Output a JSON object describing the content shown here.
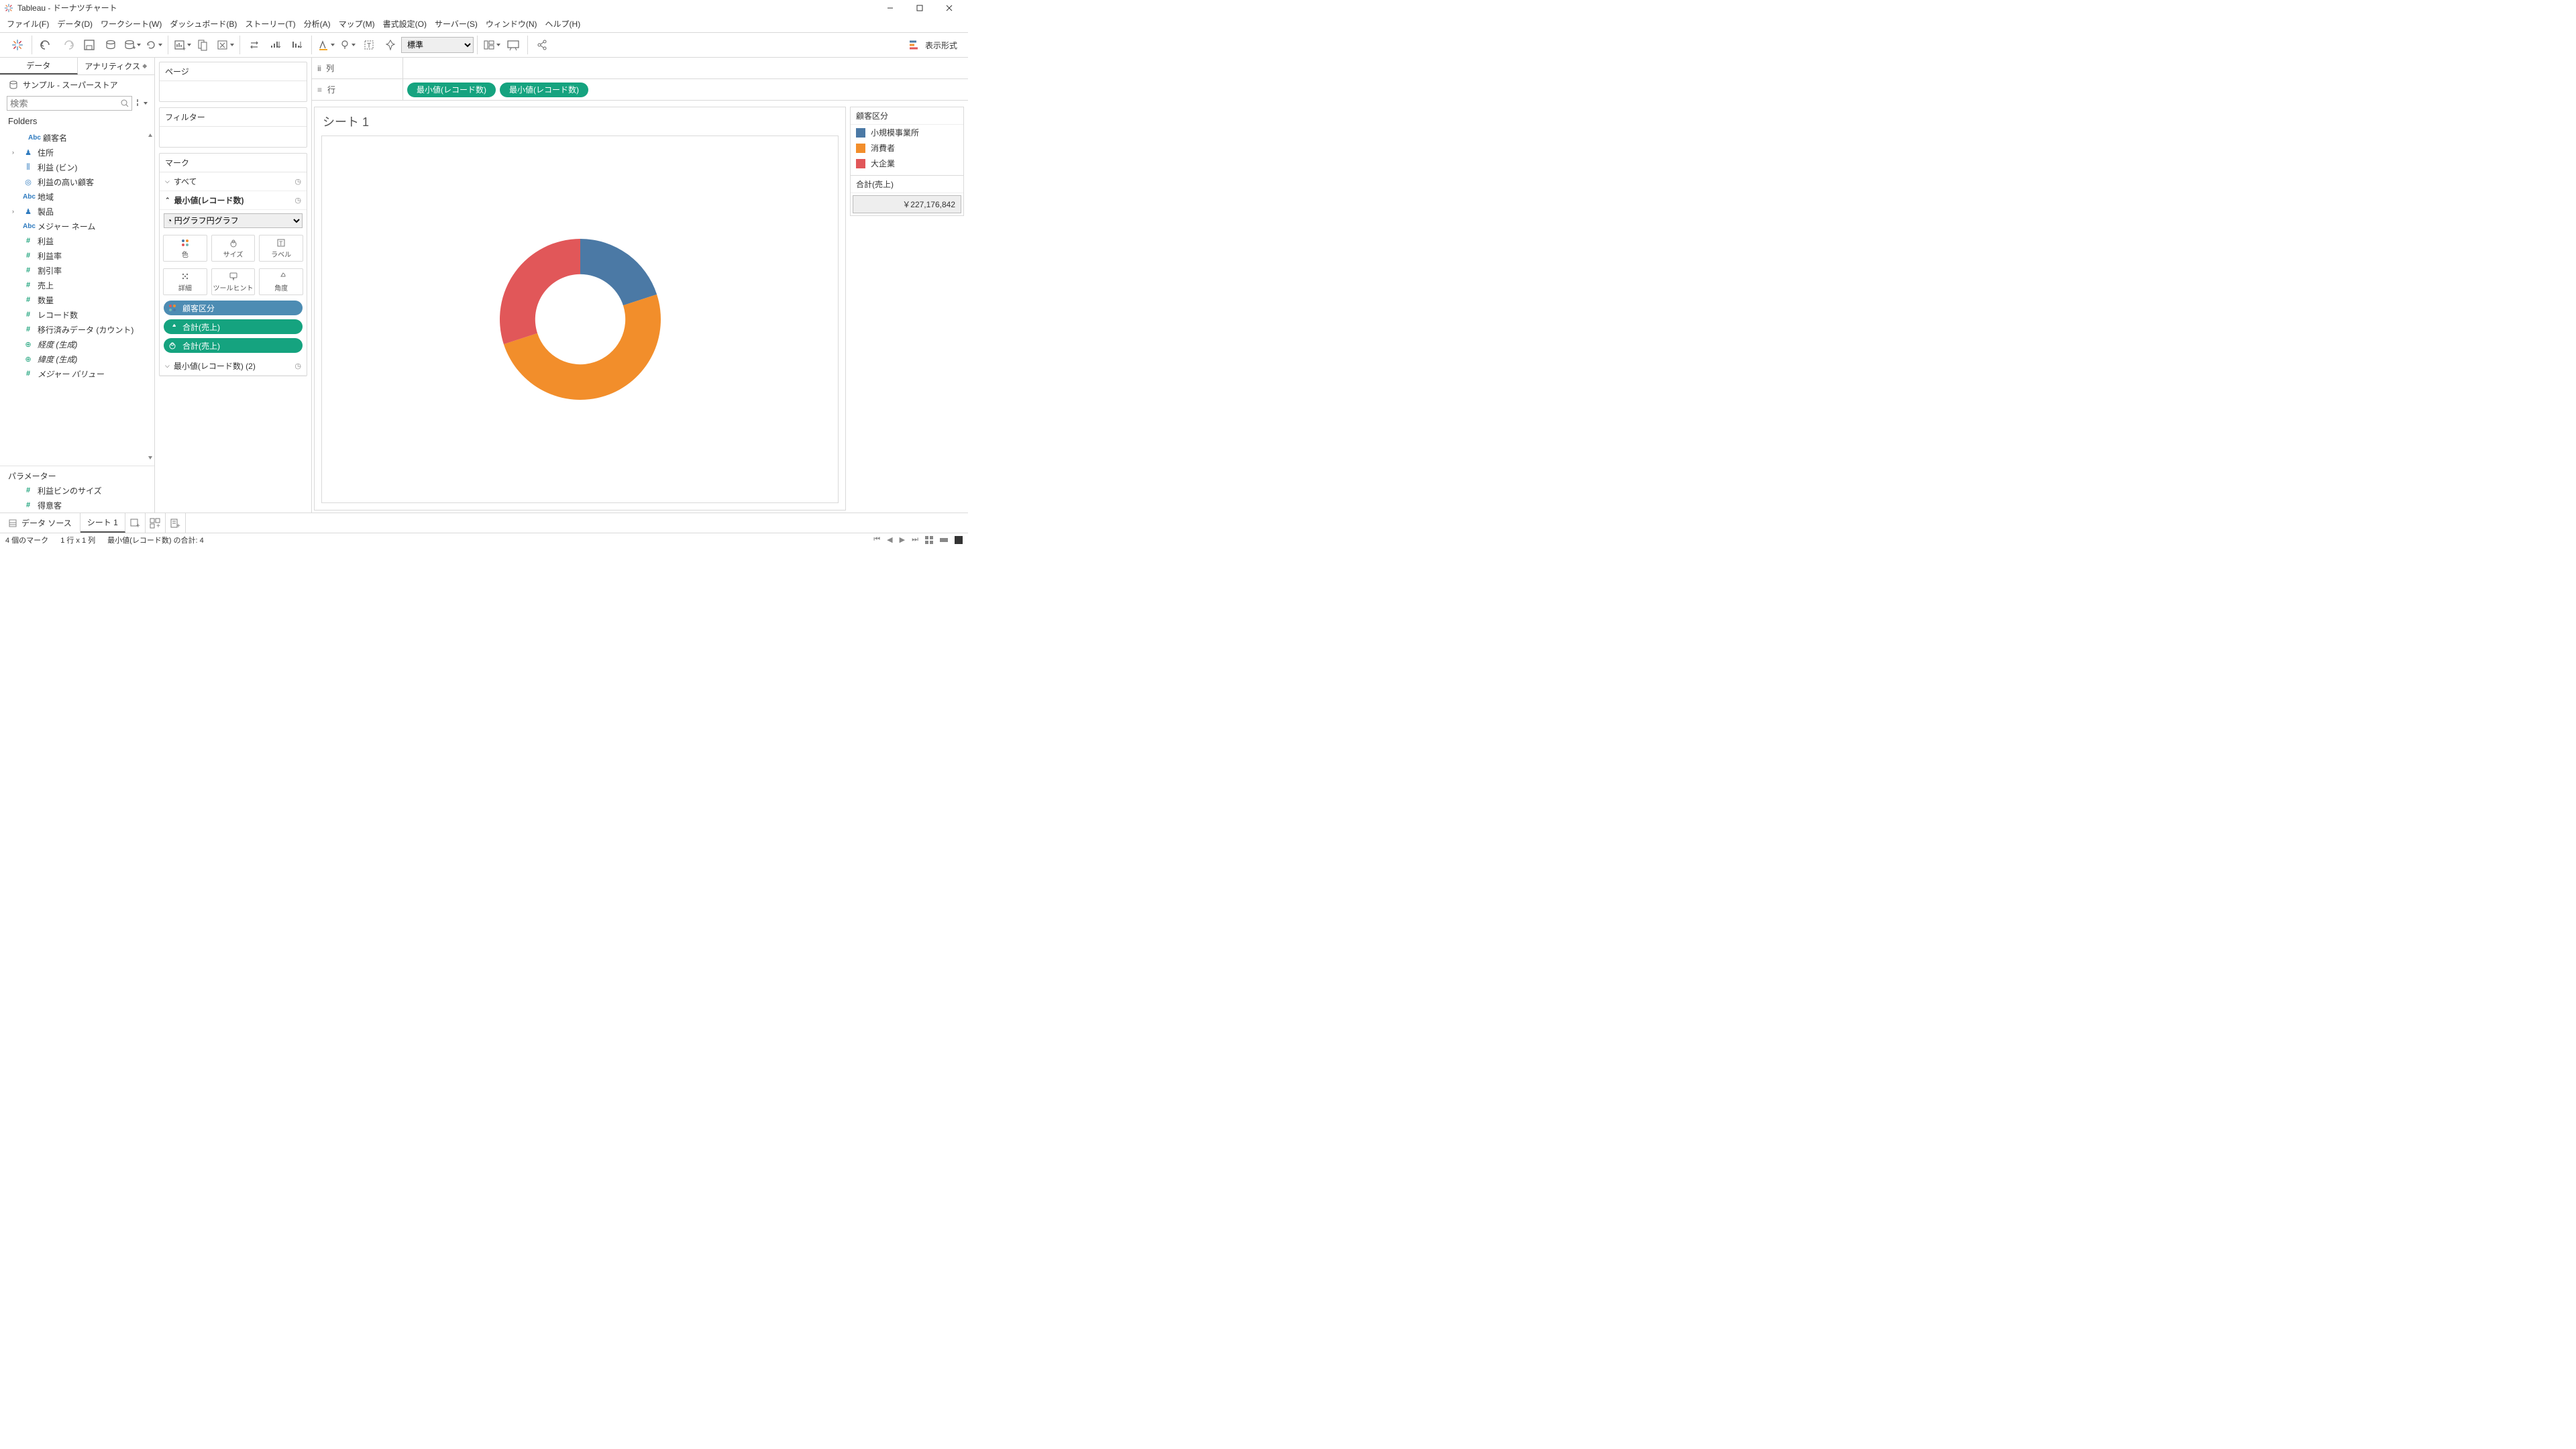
{
  "title": "Tableau - ドーナツチャート",
  "window": {
    "min": "−",
    "max": "▢",
    "close": "✕"
  },
  "menu": [
    "ファイル(F)",
    "データ(D)",
    "ワークシート(W)",
    "ダッシュボード(B)",
    "ストーリー(T)",
    "分析(A)",
    "マップ(M)",
    "書式設定(O)",
    "サーバー(S)",
    "ウィンドウ(N)",
    "ヘルプ(H)"
  ],
  "toolbar": {
    "fit": "標準",
    "showme_label": "表示形式"
  },
  "side": {
    "tabs": [
      "データ",
      "アナリティクス"
    ],
    "datasrc": "サンプル - スーパーストア",
    "search_ph": "検索",
    "folders_label": "Folders",
    "fields": [
      {
        "type": "abc",
        "label": "顧客名",
        "indent": true,
        "expand": ""
      },
      {
        "type": "people",
        "label": "住所",
        "expand": "›"
      },
      {
        "type": "bars",
        "label": "利益 (ビン)",
        "expand": ""
      },
      {
        "type": "set",
        "label": "利益の高い顧客",
        "expand": ""
      },
      {
        "type": "abc",
        "label": "地域",
        "expand": ""
      },
      {
        "type": "people",
        "label": "製品",
        "expand": "›"
      },
      {
        "type": "abc",
        "label": "メジャー ネーム",
        "expand": ""
      },
      {
        "type": "hash",
        "label": "利益",
        "expand": ""
      },
      {
        "type": "hash",
        "label": "利益率",
        "expand": ""
      },
      {
        "type": "hash",
        "label": "割引率",
        "expand": ""
      },
      {
        "type": "hash",
        "label": "売上",
        "expand": ""
      },
      {
        "type": "hash",
        "label": "数量",
        "expand": ""
      },
      {
        "type": "hash",
        "label": "レコード数",
        "expand": ""
      },
      {
        "type": "hash",
        "label": "移行済みデータ (カウント)",
        "expand": ""
      },
      {
        "type": "globe",
        "label": "経度 (生成)",
        "expand": "",
        "italic": true
      },
      {
        "type": "globe",
        "label": "緯度 (生成)",
        "expand": "",
        "italic": true
      },
      {
        "type": "hash",
        "label": "メジャー バリュー",
        "expand": "",
        "italic": true
      }
    ],
    "params_label": "パラメーター",
    "params": [
      {
        "type": "hash",
        "label": "利益ビンのサイズ"
      },
      {
        "type": "hash",
        "label": "得意客"
      }
    ]
  },
  "cards": {
    "pages": "ページ",
    "filters": "フィルター",
    "marks": "マーク",
    "rows": [
      "すべて",
      "最小値(レコード数)",
      "最小値(レコード数) (2)"
    ],
    "pie_option": "円グラフ",
    "mkicons": [
      "色",
      "サイズ",
      "ラベル",
      "詳細",
      "ツールヒント",
      "角度"
    ],
    "pills": [
      {
        "color": "blue",
        "icon": "dots",
        "label": "顧客区分"
      },
      {
        "color": "green",
        "icon": "angle",
        "label": "合計(売上)"
      },
      {
        "color": "green",
        "icon": "eye",
        "label": "合計(売上)"
      }
    ]
  },
  "shelves": {
    "col_label": "列",
    "row_label": "行",
    "row_pills": [
      "最小値(レコード数)",
      "最小値(レコード数)"
    ]
  },
  "sheet_title": "シート 1",
  "chart_data": {
    "type": "pie",
    "title": "",
    "series": [
      {
        "name": "小規模事業所",
        "value": 20,
        "color": "#4b79a5"
      },
      {
        "name": "消費者",
        "value": 50,
        "color": "#f28e2b"
      },
      {
        "name": "大企業",
        "value": 30,
        "color": "#e15759"
      }
    ],
    "inner_radius_ratio": 0.56
  },
  "legend": {
    "title": "顧客区分",
    "items": [
      {
        "color": "#4b79a5",
        "label": "小規模事業所"
      },
      {
        "color": "#f28e2b",
        "label": "消費者"
      },
      {
        "color": "#e15759",
        "label": "大企業"
      }
    ],
    "total_label": "合計(売上)",
    "total_value": "￥227,176,842"
  },
  "bottom": {
    "datasource_label": "データ ソース",
    "sheet_tab": "シート 1"
  },
  "status": {
    "marks": "4 個のマーク",
    "grid": "1 行 x 1 列",
    "sum": "最小値(レコード数) の合計: 4"
  }
}
